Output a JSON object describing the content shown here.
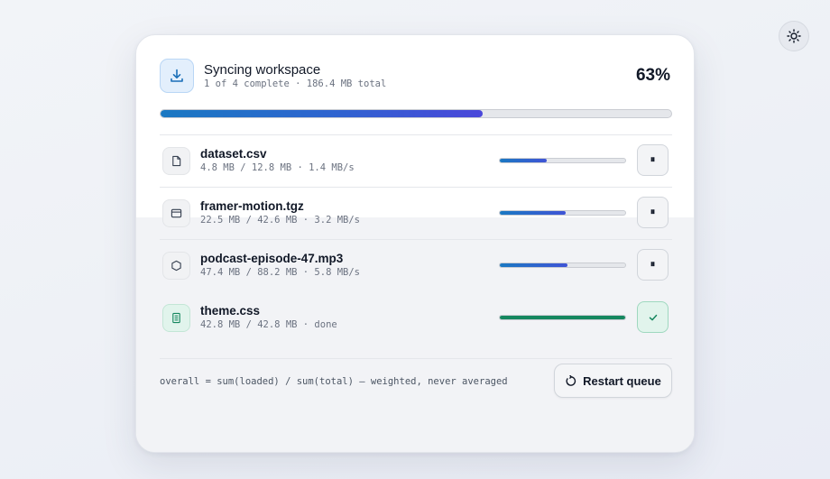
{
  "theme_toggle": {
    "icon": "sun-icon"
  },
  "header": {
    "icon": "download-icon",
    "title": "Syncing workspace",
    "subtitle": "1 of 4 complete · 186.4 MB total",
    "percent": "63%",
    "progress": 0.63
  },
  "files": [
    {
      "icon": "file-icon",
      "name": "dataset.csv",
      "meta": "4.8 MB / 12.8 MB · 1.4 MB/s",
      "progress": 0.375,
      "status": "downloading",
      "action_icon": "pause-icon",
      "action_glyph": "⏸"
    },
    {
      "icon": "window-icon",
      "name": "framer-motion.tgz",
      "meta": "22.5 MB / 42.6 MB · 3.2 MB/s",
      "progress": 0.528,
      "status": "downloading",
      "action_icon": "pause-icon",
      "action_glyph": "⏸"
    },
    {
      "icon": "hexagon-icon",
      "name": "podcast-episode-47.mp3",
      "meta": "47.4 MB / 88.2 MB · 5.8 MB/s",
      "progress": 0.537,
      "status": "downloading",
      "action_icon": "pause-icon",
      "action_glyph": "⏸"
    },
    {
      "icon": "document-icon",
      "name": "theme.css",
      "meta": "42.8 MB / 42.8 MB · done",
      "progress": 1.0,
      "status": "done",
      "action_icon": "check-icon",
      "action_glyph": "✓"
    }
  ],
  "footer": {
    "note": "overall = sum(loaded) / sum(total) — weighted, never averaged",
    "restart_label": "Restart queue",
    "restart_icon": "restart-icon"
  },
  "colors": {
    "accent_blue": "#1a78c2",
    "accent_indigo": "#4a47da",
    "success_green": "#15875f"
  }
}
